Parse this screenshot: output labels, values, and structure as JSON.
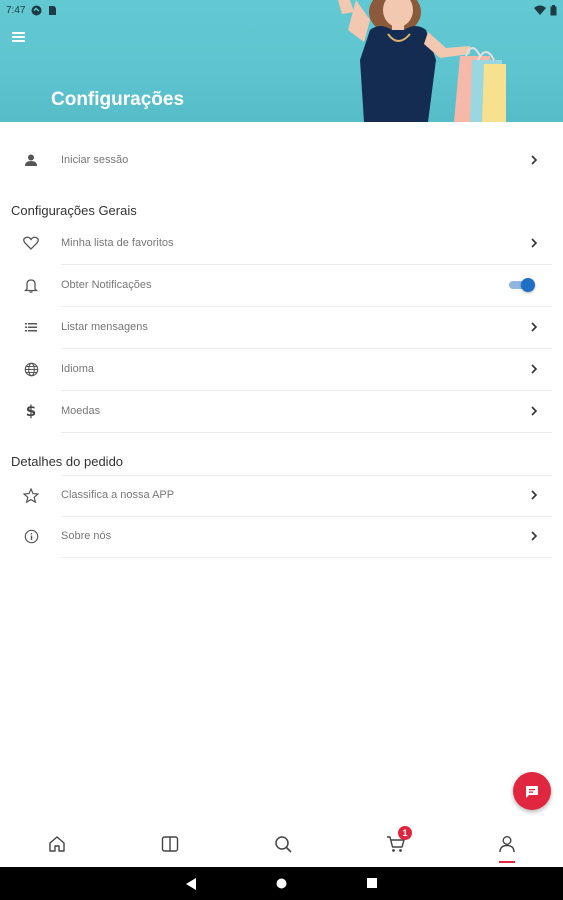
{
  "status_bar": {
    "time": "7:47"
  },
  "header": {
    "title": "Configurações"
  },
  "account": {
    "login_label": "Iniciar sessão"
  },
  "general_settings": {
    "title": "Configurações Gerais",
    "items": [
      {
        "label": "Minha lista de favoritos",
        "icon": "heart-icon"
      },
      {
        "label": "Obter Notificações",
        "icon": "bell-icon",
        "toggle_on": true
      },
      {
        "label": "Listar mensagens",
        "icon": "list-icon"
      },
      {
        "label": "Idioma",
        "icon": "globe-icon"
      },
      {
        "label": "Moedas",
        "icon": "dollar-icon"
      }
    ]
  },
  "order_details": {
    "title": "Detalhes do pedido",
    "items": [
      {
        "label": "Classifica a nossa APP",
        "icon": "star-icon"
      },
      {
        "label": "Sobre nós",
        "icon": "info-icon"
      }
    ]
  },
  "bottom_nav": {
    "items": [
      "home-icon",
      "book-icon",
      "search-icon",
      "cart-icon",
      "profile-icon"
    ],
    "cart_badge": "1",
    "active": "profile-icon"
  },
  "colors": {
    "accent": "#e1263f",
    "header": "#5ec4cf",
    "toggle": "#1f6fc4"
  }
}
